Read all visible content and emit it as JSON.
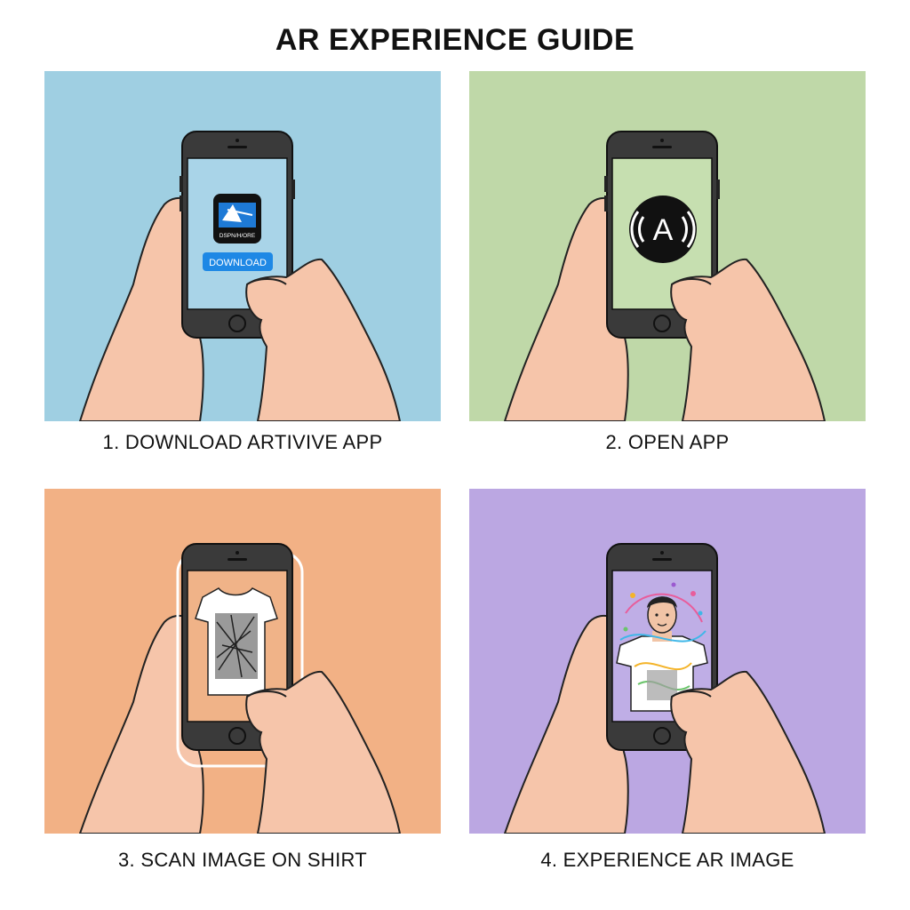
{
  "title": "AR EXPERIENCE GUIDE",
  "colors": {
    "panel1": "#9fcfe2",
    "panel2": "#bfd8a8",
    "panel3": "#f2b185",
    "panel4": "#bba7e2",
    "skin": "#f6c5aa",
    "phone": "#3a3a3a",
    "download_button": "#1e88e5"
  },
  "steps": [
    {
      "caption": "1. DOWNLOAD ARTIVIVE APP",
      "screen": {
        "app_icon": "artivive-app-icon",
        "app_name": "DSPN/H/ORE",
        "button_label": "DOWNLOAD"
      }
    },
    {
      "caption": "2. OPEN APP",
      "screen": {
        "app_icon": "artivive-logo-icon",
        "logo_letter": "A"
      }
    },
    {
      "caption": "3. SCAN IMAGE ON SHIRT",
      "screen": {
        "image": "tshirt-geometric-print"
      }
    },
    {
      "caption": "4. EXPERIENCE AR IMAGE",
      "screen": {
        "image": "ar-person-with-colorful-swirls"
      }
    }
  ]
}
